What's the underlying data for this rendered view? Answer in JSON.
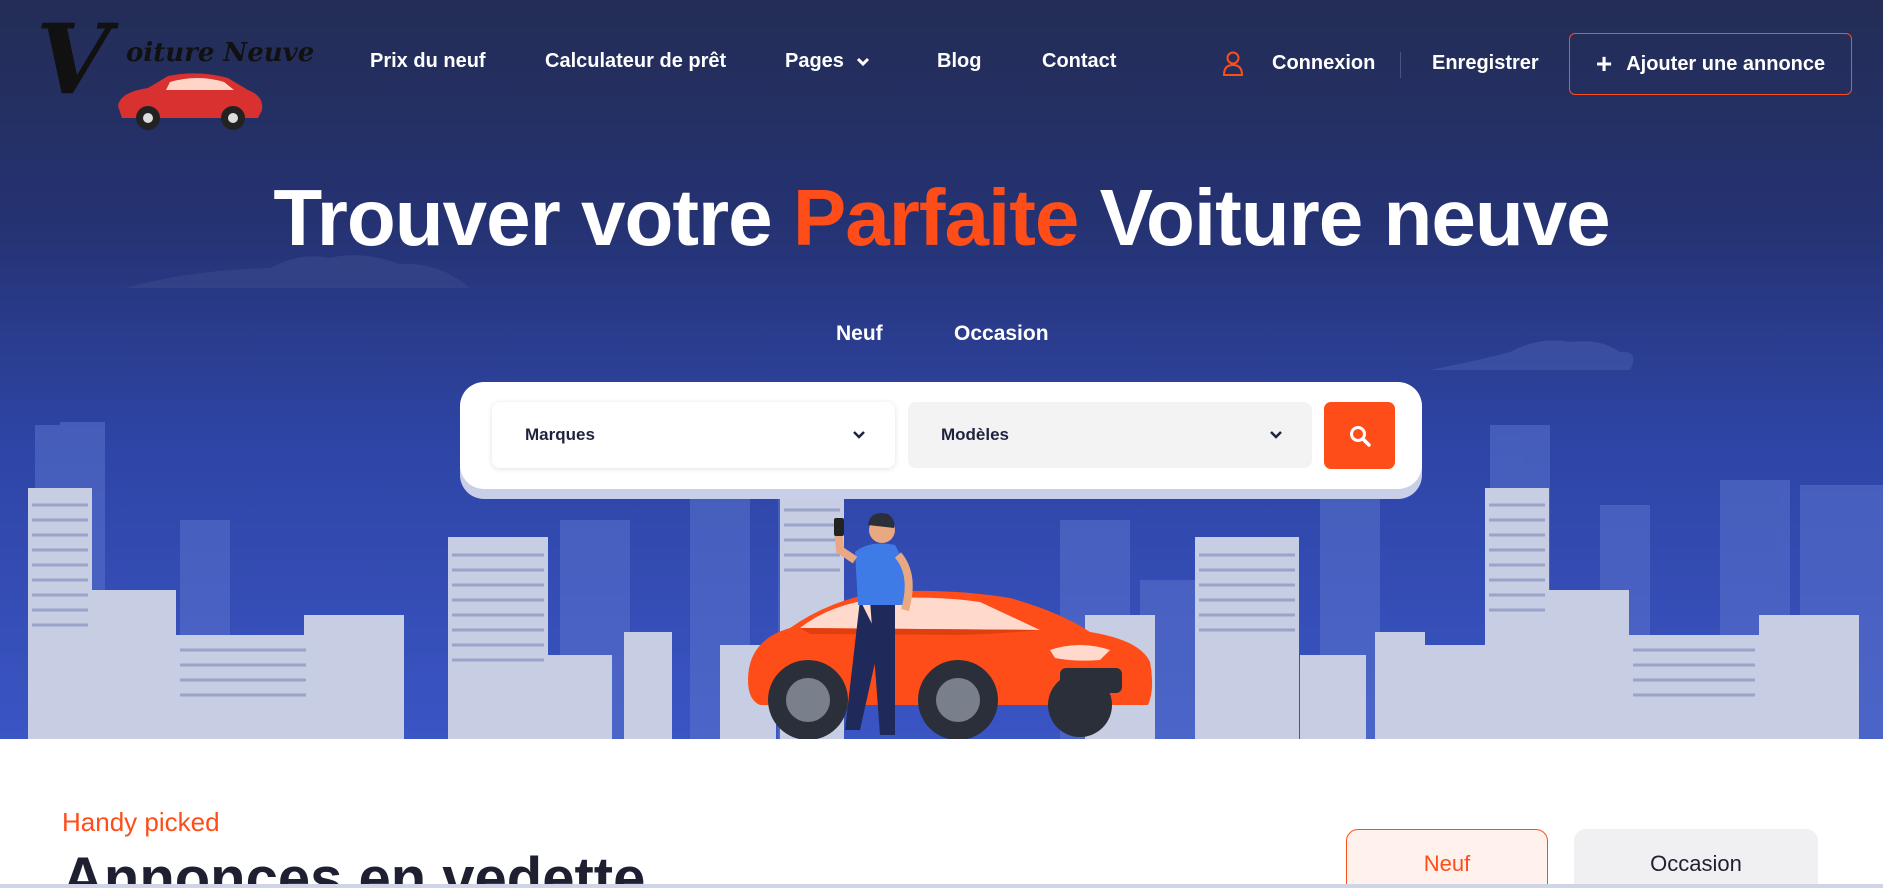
{
  "logo": {
    "text": "oiture Neuve",
    "initial": "V"
  },
  "nav": {
    "items": [
      {
        "label": "Prix du neuf"
      },
      {
        "label": "Calculateur de prêt"
      },
      {
        "label": "Pages",
        "has_dropdown": true
      },
      {
        "label": "Blog"
      },
      {
        "label": "Contact"
      }
    ],
    "login_label": "Connexion",
    "register_label": "Enregistrer",
    "add_listing_label": "Ajouter une annonce"
  },
  "hero": {
    "title_part1": "Trouver votre",
    "title_accent": "Parfaite",
    "title_part2": "Voiture neuve",
    "tabs": [
      "Neuf",
      "Occasion"
    ]
  },
  "search": {
    "brand_label": "Marques",
    "model_label": "Modèles",
    "button_icon": "search-icon"
  },
  "featured": {
    "kicker": "Handy picked",
    "title": "Annonces en vedette",
    "tabs": [
      "Neuf",
      "Occasion"
    ],
    "active_tab": "Neuf"
  },
  "colors": {
    "accent": "#ff4d1a",
    "hero_top": "#232d55",
    "hero_bottom": "#3a55c4",
    "text_dark": "#1e2031"
  }
}
